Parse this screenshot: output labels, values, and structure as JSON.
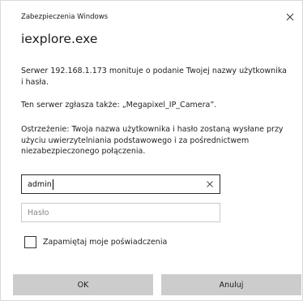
{
  "window": {
    "title": "Zabezpieczenia Windows",
    "close_icon": "close-icon"
  },
  "header": {
    "title": "iexplore.exe"
  },
  "messages": {
    "server_request": "Serwer 192.168.1.173 monituje o podanie Twojej nazwy użytkownika i hasła.",
    "server_report": "Ten serwer zgłasza także: „Megapixel_IP_Camera”.",
    "warning": "Ostrzeżenie: Twoja nazwa użytkownika i hasło zostaną wysłane przy użyciu uwierzytelniania podstawowego i za pośrednictwem niezabezpieczonego połączenia."
  },
  "form": {
    "username_value": "admin",
    "password_placeholder": "Hasło",
    "remember_label": "Zapamiętaj moje poświadczenia",
    "remember_checked": false
  },
  "buttons": {
    "ok_label": "OK",
    "cancel_label": "Anuluj"
  },
  "colors": {
    "button_bg": "#cccccc",
    "focused_border": "#2b2b2b",
    "inactive_border": "#c9c9c9"
  }
}
